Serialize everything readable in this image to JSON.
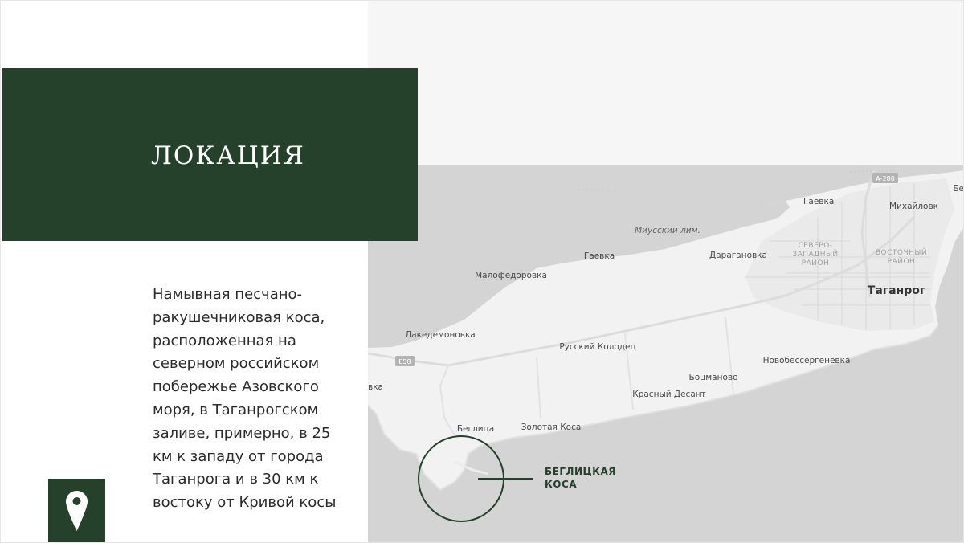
{
  "title": "ЛОКАЦИЯ",
  "description": "Намывная песчано-\nракушечниковая коса,\nрасположенная на\nсеверном российском\nпобережье Азовского\nморя, в Таганрогском\nзаливе, примерно, в 25\nкм к западу от города\nТаганрога и в 30 км к\nвостоку от Кривой косы",
  "colors": {
    "accent": "#25402b",
    "land": "#f3f3f3",
    "water": "#d4d4d4"
  },
  "icons": {
    "location": "map-pin-icon"
  },
  "map": {
    "labels": {
      "miussky_liman": "Миусский лим.",
      "gaevka_top": "Гаевка",
      "mikhailovka": "Михайловк",
      "be": "Бе",
      "gaevka": "Гаевка",
      "daraganovka": "Дарагановка",
      "malofedorovka": "Малофедоровка",
      "severo_zapadny_1": "СЕВЕРО-",
      "severo_zapadny_2": "ЗАПАДНЫЙ",
      "severo_zapadny_3": "РАЙОН",
      "vostochny_1": "ВОСТОЧНЫЙ",
      "vostochny_2": "РАЙОН",
      "taganrog": "Таганрог",
      "lakedemonovka": "Лакедемоновка",
      "russky_kolodets": "Русский Колодец",
      "novobessergenevka": "Новобессергеневка",
      "vka": "вка",
      "botsmanovo": "Боцманово",
      "krasny_desant": "Красный Десант",
      "beglitsa": "Беглица",
      "zolotaya_kosa": "Золотая Коса"
    },
    "roads": {
      "a280": "А-280",
      "e58": "E58"
    },
    "callout": {
      "line1": "БЕГЛИЦКАЯ",
      "line2": "КОСА"
    }
  }
}
